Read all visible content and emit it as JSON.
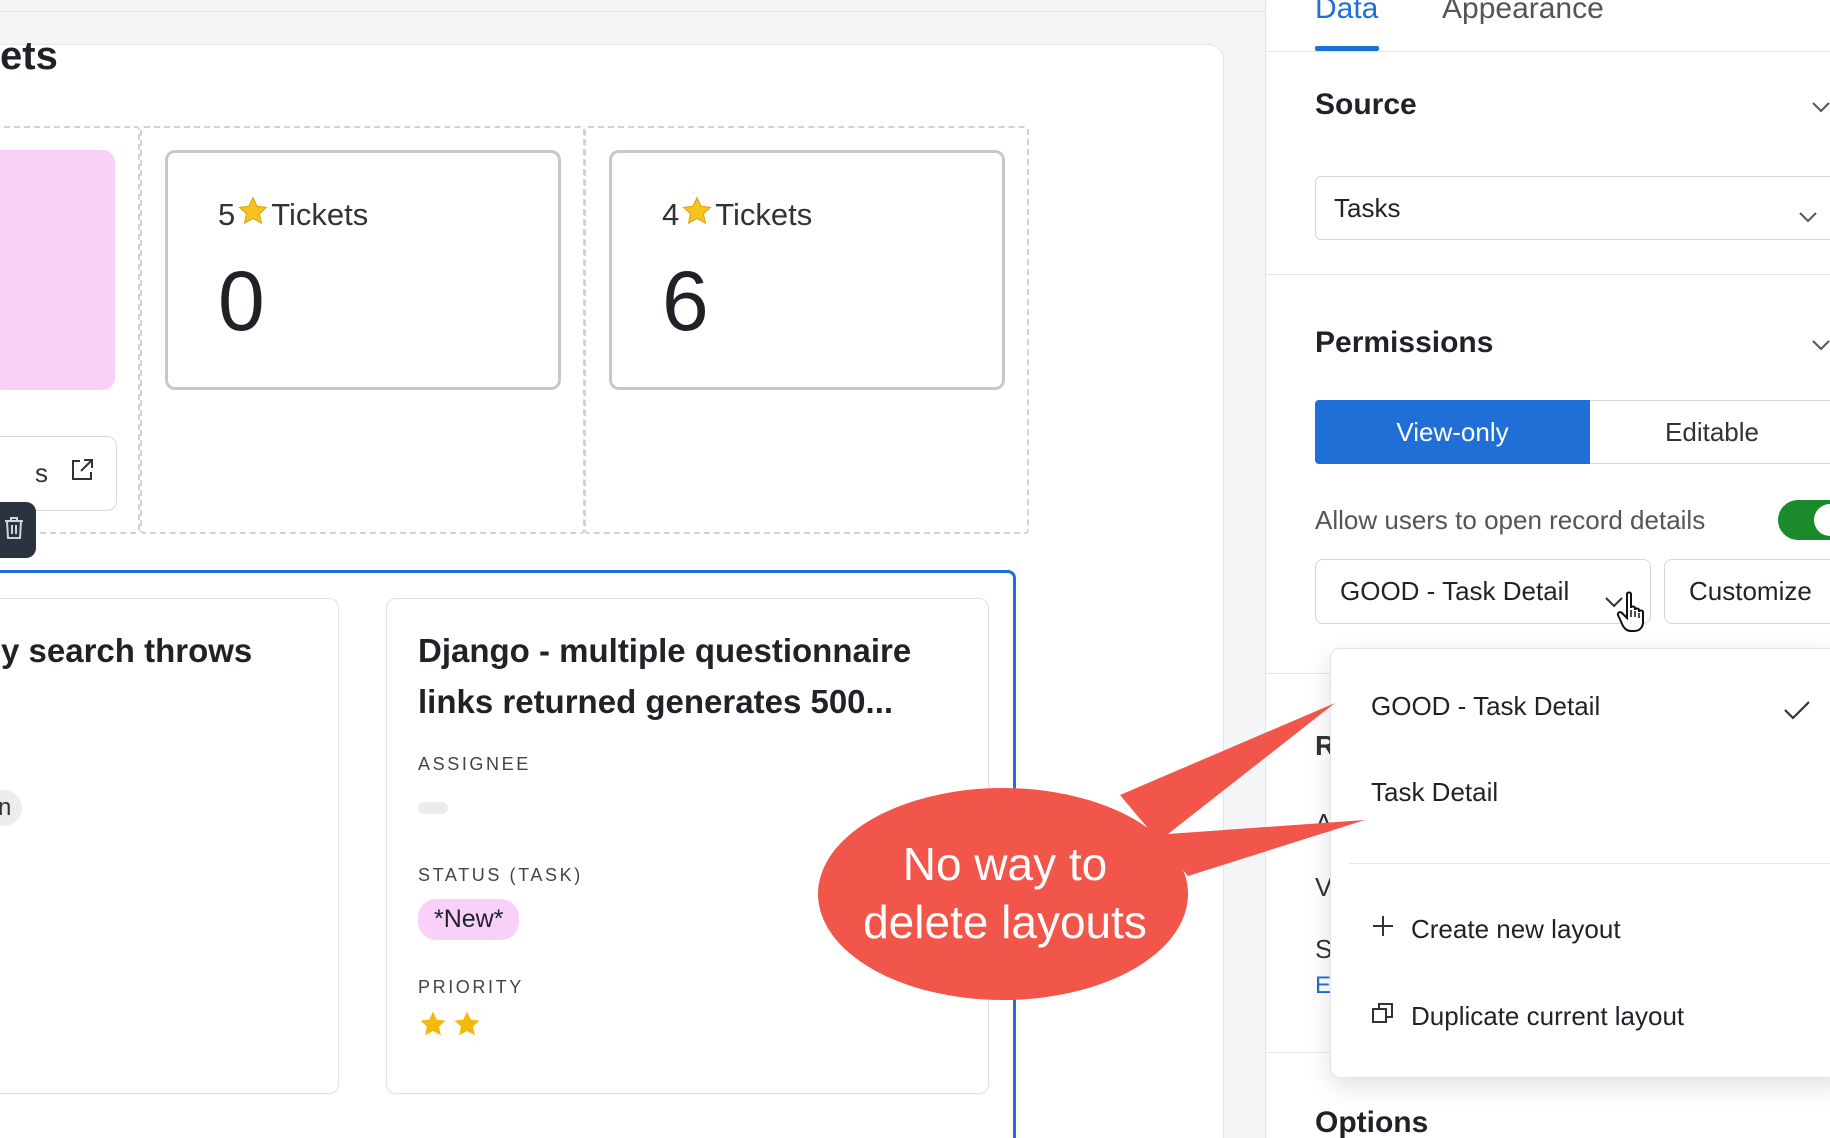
{
  "canvas": {
    "title_fragment": "ets",
    "link_button_fragment": "s",
    "kpis": [
      {
        "stars": "5",
        "label": "Tickets",
        "value": "0"
      },
      {
        "stars": "4",
        "label": "Tickets",
        "value": "6"
      }
    ],
    "cards": [
      {
        "title_fragment": "y search throws",
        "chip_fragment": "n"
      },
      {
        "title_line1": "Django - multiple questionnaire",
        "title_line2": "links returned generates 500...",
        "assignee_label": "ASSIGNEE",
        "status_label": "STATUS (TASK)",
        "status_value": "*New*",
        "priority_label": "PRIORITY",
        "priority_stars": 2
      }
    ]
  },
  "panel": {
    "tabs": [
      {
        "label": "Data",
        "active": true
      },
      {
        "label": "Appearance",
        "active": false
      }
    ],
    "source": {
      "title": "Source",
      "selected": "Tasks"
    },
    "permissions": {
      "title": "Permissions",
      "options": [
        "View-only",
        "Editable"
      ],
      "selected": "View-only",
      "toggle_label": "Allow users to open record details",
      "toggle_on": true,
      "layout_selected": "GOOD - Task Detail",
      "customize_label": "Customize"
    },
    "peek_letters": {
      "r": "R",
      "a": "A",
      "v": "V",
      "s": "S",
      "e": "Ec"
    },
    "options_title": "Options"
  },
  "layout_menu": {
    "items": [
      {
        "label": "GOOD - Task Detail",
        "checked": true
      },
      {
        "label": "Task Detail",
        "checked": false
      }
    ],
    "actions": [
      {
        "label": "Create new layout",
        "icon": "plus-icon"
      },
      {
        "label": "Duplicate current layout",
        "icon": "duplicate-icon"
      }
    ]
  },
  "annotation": {
    "line1": "No way to",
    "line2": "delete layouts",
    "color": "#f2554a"
  },
  "colors": {
    "accent": "#1f6fd6",
    "toggle_on": "#1a8a2b",
    "pink": "#f9d1f8"
  }
}
